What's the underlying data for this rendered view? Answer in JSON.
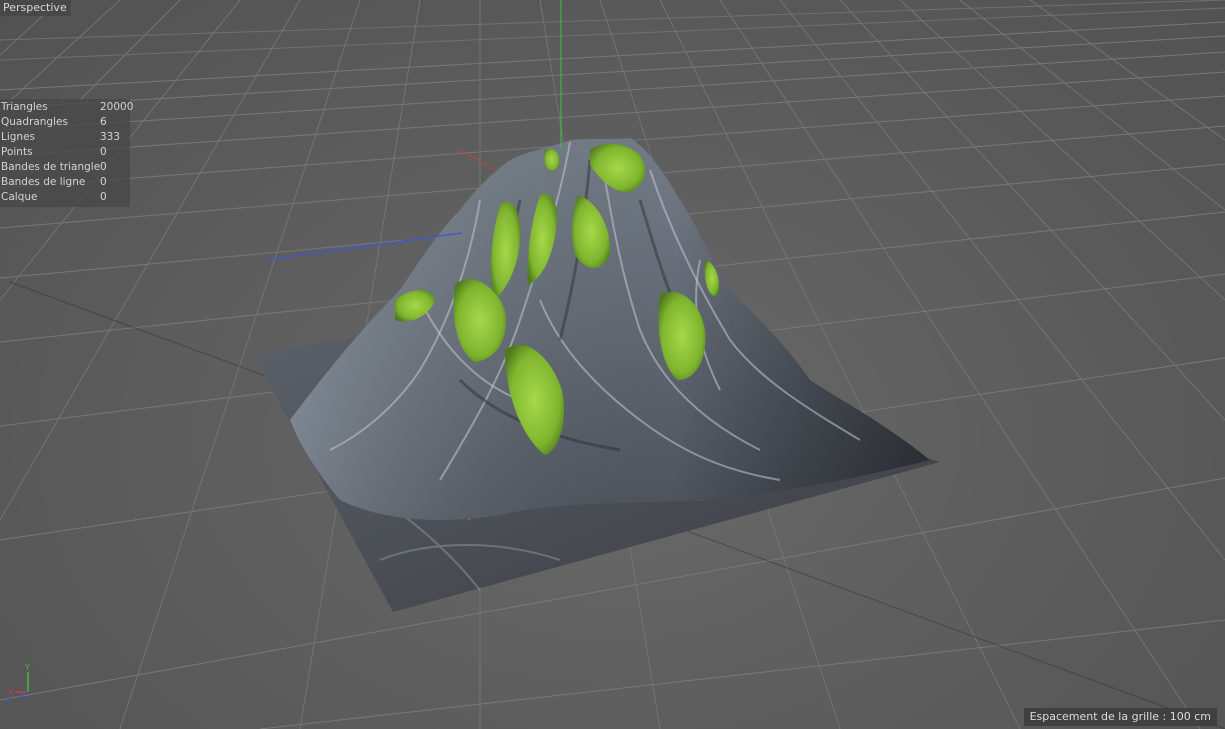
{
  "viewport": {
    "name": "Perspective",
    "grid_spacing": "Espacement de la grille : 100 cm"
  },
  "stats": [
    {
      "label": "Triangles",
      "value": "20000"
    },
    {
      "label": "Quadrangles",
      "value": "6"
    },
    {
      "label": "Lignes",
      "value": "333"
    },
    {
      "label": "Points",
      "value": "0"
    },
    {
      "label": "Bandes de triangle",
      "value": "0"
    },
    {
      "label": "Bandes de ligne",
      "value": "0"
    },
    {
      "label": "Calque",
      "value": "0"
    }
  ],
  "axes": {
    "y_label": "Y",
    "x_label": "X",
    "z_label": "Z",
    "x_color": "#d23c3c",
    "y_color": "#3fbf3f",
    "z_color": "#3f53d8"
  },
  "colors": {
    "grid_line": "#7a7a7a",
    "rock": "#6f7782",
    "moss": "#8cc43a"
  }
}
